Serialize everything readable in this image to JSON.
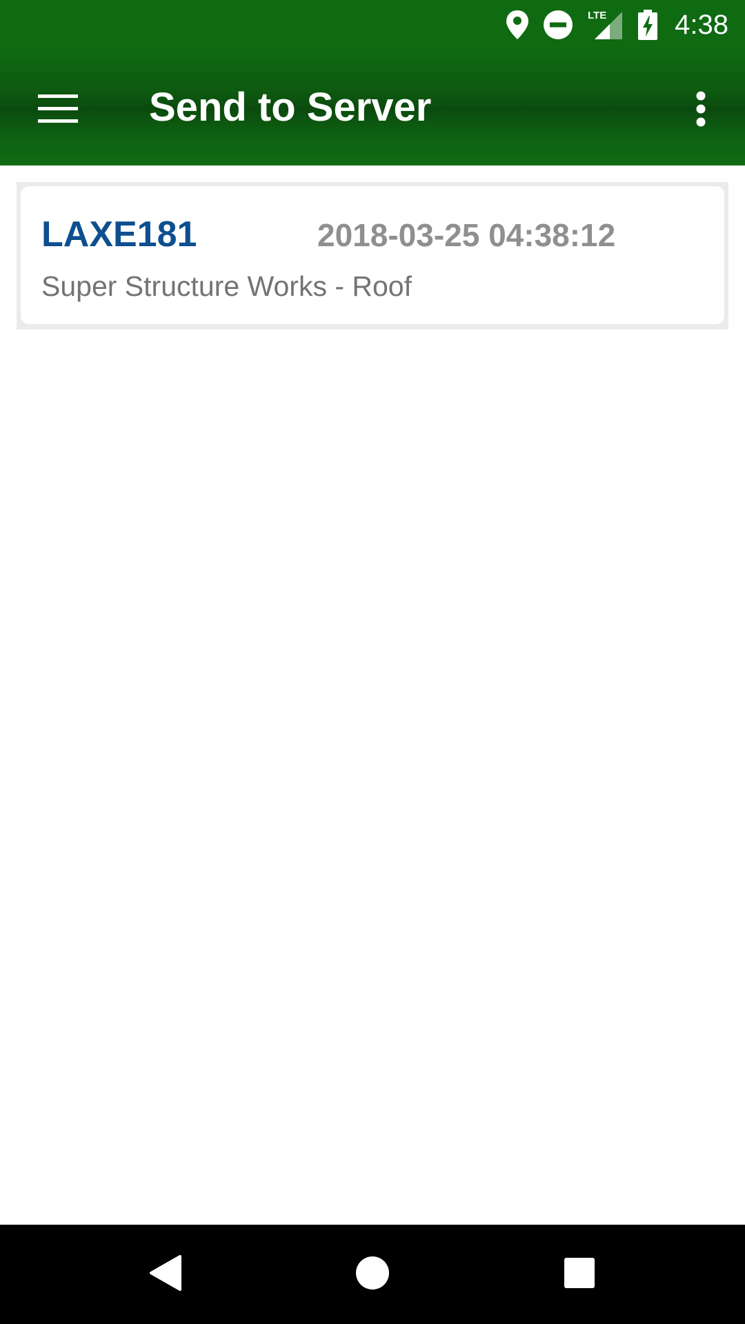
{
  "status_bar": {
    "time": "4:38",
    "network_label": "LTE",
    "icons": [
      "location-icon",
      "do-not-disturb-icon",
      "lte-signal-icon",
      "battery-charging-icon"
    ]
  },
  "app_bar": {
    "title": "Send to Server",
    "menu_icon": "hamburger-menu-icon",
    "overflow_icon": "more-vert-icon"
  },
  "list": {
    "items": [
      {
        "code": "LAXE181",
        "datetime": "2018-03-25 04:38:12",
        "subtitle": "Super Structure Works - Roof"
      }
    ]
  },
  "nav_bar": {
    "icons": [
      "back-icon",
      "home-icon",
      "recents-icon"
    ]
  },
  "colors": {
    "header_green": "#0f6b12",
    "code_blue": "#0d4f8f",
    "date_gray": "#8f8f8f",
    "subtitle_gray": "#737373"
  }
}
